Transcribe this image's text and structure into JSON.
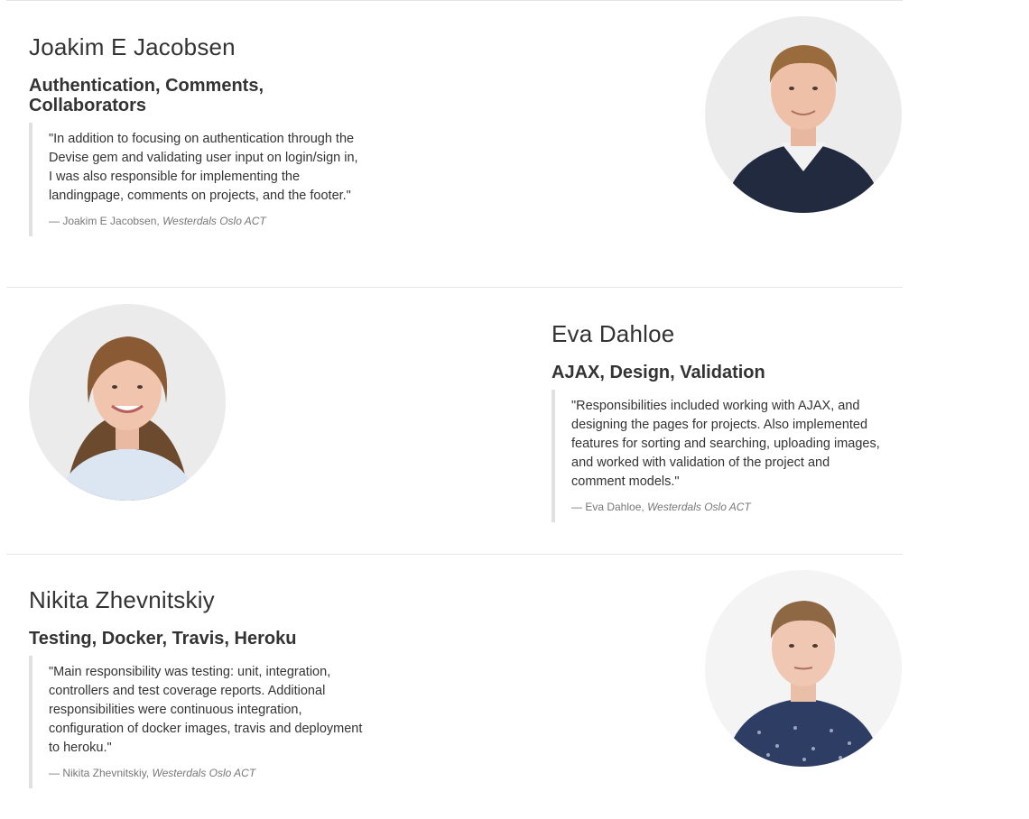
{
  "members": [
    {
      "name": "Joakim E Jacobsen",
      "role": "Authentication, Comments, Collaborators",
      "quote": "\"In addition to focusing on authentication through the Devise gem and validating user input on login/sign in, I was also responsible for implementing the landingpage, comments on projects, and the footer.\"",
      "attribution": "— Joakim E Jacobsen,",
      "organization": "Westerdals Oslo ACT",
      "photo_icon": "person-photo"
    },
    {
      "name": "Eva Dahloe",
      "role": "AJAX, Design, Validation",
      "quote": "\"Responsibilities included working with AJAX, and designing the pages for projects. Also implemented features for sorting and searching, uploading images, and worked with validation of the project and comment models.\"",
      "attribution": "— Eva Dahloe,",
      "organization": "Westerdals Oslo ACT",
      "photo_icon": "person-photo"
    },
    {
      "name": "Nikita Zhevnitskiy",
      "role": "Testing, Docker, Travis, Heroku",
      "quote": "\"Main responsibility was testing: unit, integration, controllers and test coverage reports. Additional responsibilities were continuous integration, configuration of docker images, travis and deployment to heroku.\"",
      "attribution": "— Nikita Zhevnitskiy,",
      "organization": "Westerdals Oslo ACT",
      "photo_icon": "person-photo"
    }
  ],
  "colors": {
    "text": "#333333",
    "muted": "#777777",
    "divider": "#e6e6e6",
    "quote_border": "#e0e0e0"
  }
}
